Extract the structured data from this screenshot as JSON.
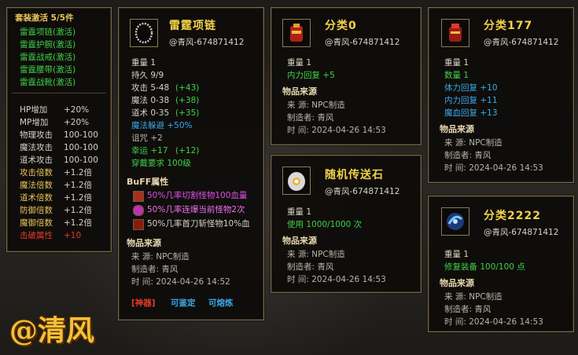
{
  "set_panel": {
    "title": "套装激活 5/5件",
    "items": [
      "雷霆项链(激活)",
      "雷霆护腕(激活)",
      "雷霆战戒(激活)",
      "雷霆腰带(激活)",
      "雷霆战靴(激活)"
    ],
    "stats": [
      {
        "label": "HP增加",
        "value": "+20%"
      },
      {
        "label": "MP增加",
        "value": "+20%"
      },
      {
        "label": "物理攻击",
        "value": "100-100"
      },
      {
        "label": "魔法攻击",
        "value": "100-100"
      },
      {
        "label": "道术攻击",
        "value": "100-100"
      },
      {
        "label": "攻击倍数",
        "value": "+1.2倍"
      },
      {
        "label": "魔法倍数",
        "value": "+1.2倍"
      },
      {
        "label": "道术倍数",
        "value": "+1.2倍"
      },
      {
        "label": "防御倍数",
        "value": "+1.2倍"
      },
      {
        "label": "魔御倍数",
        "value": "+1.2倍"
      }
    ],
    "crit": {
      "label": "击破属性",
      "value": "+10"
    }
  },
  "necklace": {
    "name": "雷霆项链",
    "owner": "@青风-674871412",
    "icon": "necklace-icon",
    "weight": "重量 1",
    "durability": "持久 9/9",
    "attack": "攻击 5-48",
    "attack_bonus": "(+43)",
    "magic": "魔法 0-38",
    "magic_bonus": "(+38)",
    "tao": "道术 0-35",
    "tao_bonus": "(+35)",
    "magic_dodge": "魔法躲避 +50%",
    "curse": "诅咒 +2",
    "luck": "幸运 +17",
    "luck_bonus": "(+12)",
    "requirement": "穿戴要求 100级",
    "buff_title": "BuFF属性",
    "buffs": [
      "50%几率切割怪物100血量",
      "50%几率连爆当前怪物2次",
      "50%几率首刀斩怪物10%血"
    ],
    "source_title": "物品来源",
    "source": "来  源: NPC制造",
    "maker": "制造者: 青风",
    "time": "时  间: 2024-04-26 14:52",
    "tag_shenqi": "[神器]",
    "tag_identify": "可鉴定",
    "tag_smelt": "可熔炼"
  },
  "item0": {
    "name": "分类0",
    "owner": "@青风-674871412",
    "icon": "potion-red-icon",
    "weight": "重量 1",
    "effect": "内力回复 +5",
    "source_title": "物品来源",
    "source": "来  源: NPC制造",
    "maker": "制造者: 青风",
    "time": "时  间: 2024-04-26 14:53"
  },
  "stone": {
    "name": "随机传送石",
    "owner": "@青风-674871412",
    "icon": "teleport-stone-icon",
    "weight": "重量 1",
    "use": "使用 1000/1000 次",
    "source_title": "物品来源",
    "source": "来  源: NPC制造",
    "maker": "制造者: 青风",
    "time": "时  间: 2024-04-26 14:53"
  },
  "item177": {
    "name": "分类177",
    "owner": "@青风-674871412",
    "icon": "potion-bag-icon",
    "weight": "重量 1",
    "count": "数量 1",
    "hp": "体力回复 +10",
    "mp": "内力回复 +11",
    "blood": "魔血回复 +13",
    "source_title": "物品来源",
    "source": "来  源: NPC制造",
    "maker": "制造者: 青风",
    "time": "时  间: 2024-04-26 14:53"
  },
  "item2222": {
    "name": "分类2222",
    "owner": "@青风-674871412",
    "icon": "blue-orb-icon",
    "weight": "重量 1",
    "repair": "修复装备 100/100 点",
    "source_title": "物品来源",
    "source": "来  源: NPC制造",
    "maker": "制造者: 青风",
    "time": "时  间: 2024-04-26 14:53"
  },
  "watermark": "@清风"
}
